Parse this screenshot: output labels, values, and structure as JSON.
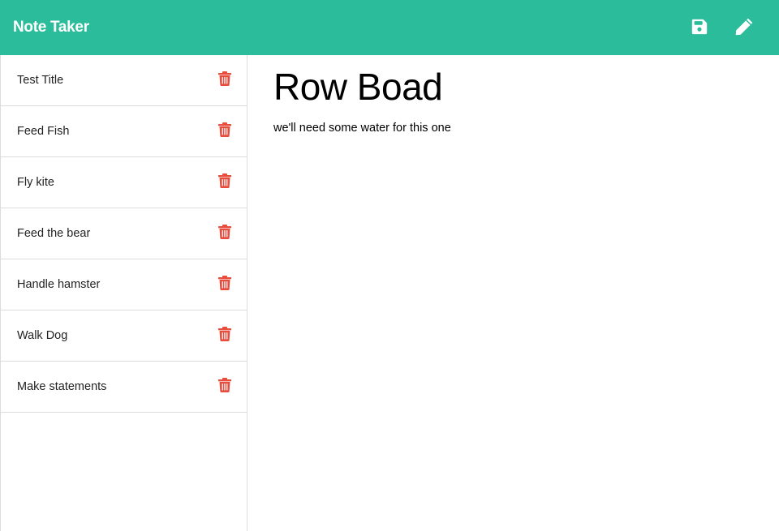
{
  "app": {
    "title": "Note Taker",
    "accent_color": "#2bbd9b",
    "delete_color": "#e74c3c"
  },
  "toolbar": {
    "save_icon": "save-icon",
    "edit_icon": "pencil-icon"
  },
  "sidebar": {
    "items": [
      {
        "label": "Test Title"
      },
      {
        "label": "Feed Fish"
      },
      {
        "label": "Fly kite"
      },
      {
        "label": "Feed the bear"
      },
      {
        "label": "Handle hamster"
      },
      {
        "label": "Walk Dog"
      },
      {
        "label": "Make statements"
      }
    ],
    "delete_icon": "trash-icon"
  },
  "main": {
    "note_title": "Row Boad",
    "note_text": "we'll need some water for this one"
  }
}
